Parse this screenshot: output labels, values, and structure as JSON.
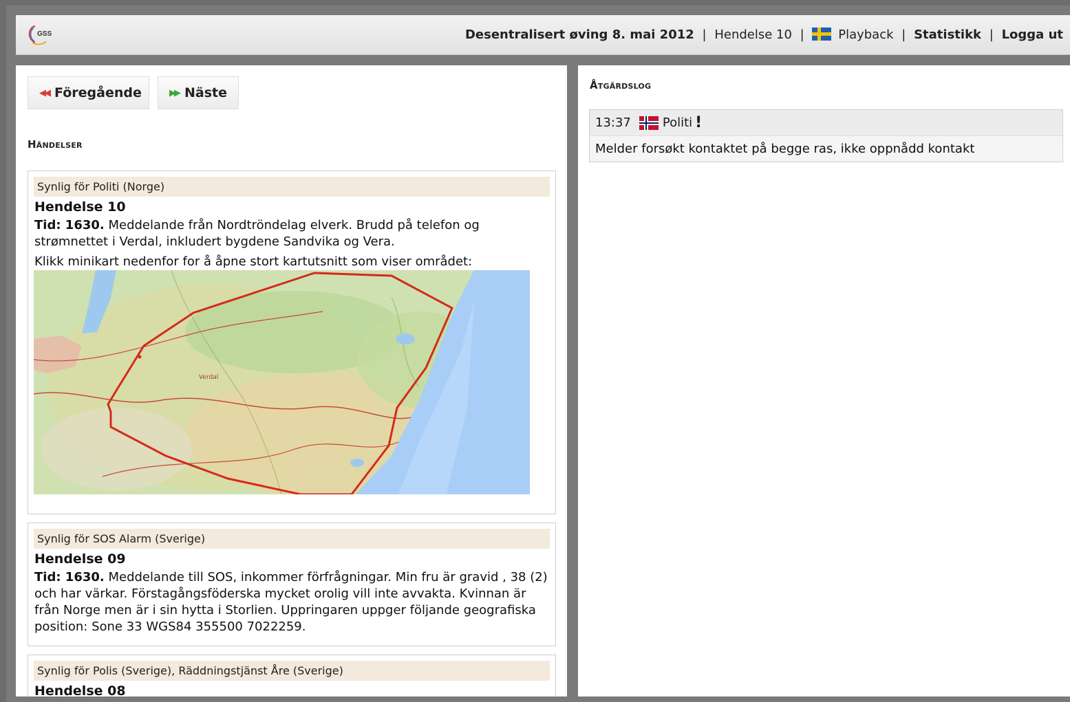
{
  "header": {
    "logo_text": "GSS",
    "exercise_title": "Desentralisert øving 8. mai 2012",
    "sep": "|",
    "current_event": "Hendelse 10",
    "playback_label": "Playback",
    "statistics_label": "Statistikk",
    "logout_label": "Logga ut"
  },
  "nav": {
    "prev_label": "Föregående",
    "next_label": "Näste"
  },
  "events_section_title": "Händelser",
  "events": [
    {
      "visible_for": "Synlig för Politi (Norge)",
      "title": "Hendelse 10",
      "time_label": "Tid: 1630.",
      "text": "Meddelande från Nordtröndelag elverk. Brudd på telefon og strømnettet i Verdal, inkludert bygdene Sandvika og Vera.",
      "map_note": "Klikk minikart nedenfor for å åpne stort kartutsnitt som viser området:",
      "map_label": "Verdal"
    },
    {
      "visible_for": "Synlig för SOS Alarm (Sverige)",
      "title": "Hendelse 09",
      "time_label": "Tid: 1630.",
      "text": "Meddelande till SOS, inkommer förfrågningar. Min fru är gravid , 38 (2) och har värkar. Förstagångsföderska mycket orolig vill inte avvakta. Kvinnan är från Norge men är i sin hytta i Storlien. Uppringaren uppger följande geografiska position: Sone 33 WGS84 355500 7022259."
    },
    {
      "visible_for": "Synlig för Polis (Sverige), Räddningstjänst Åre (Sverige)",
      "title": "Hendelse 08"
    }
  ],
  "log_section_title": "Åtgärdslog",
  "log_entries": [
    {
      "time": "13:37",
      "flag": "norway-flag",
      "actor": "Politi",
      "marker": "!",
      "message": "Melder forsøkt kontaktet på begge ras, ikke oppnådd kontakt"
    }
  ],
  "colors": {
    "prev_arrow": "#d83b3b",
    "next_arrow": "#3aa83a",
    "visible_bar": "#f3e9dc",
    "map_outline": "#d42a1a",
    "sea": "#a8cdf7"
  }
}
